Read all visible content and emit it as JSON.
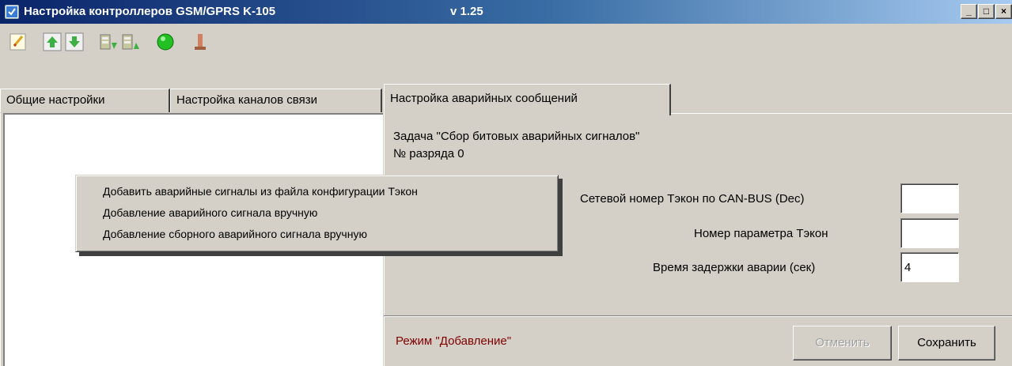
{
  "window": {
    "title": "Настройка контроллеров GSM/GPRS K-105",
    "version": "v 1.25",
    "controls": {
      "minimize": "_",
      "maximize": "□",
      "close": "×"
    }
  },
  "toolbar": {
    "buttons": [
      {
        "name": "new-icon"
      },
      {
        "name": "arrow-up-icon"
      },
      {
        "name": "arrow-down-icon"
      },
      {
        "name": "db-import-icon"
      },
      {
        "name": "db-export-icon"
      },
      {
        "name": "connect-green-icon"
      },
      {
        "name": "disconnect-icon"
      }
    ]
  },
  "tabs": [
    {
      "label": "Общие настройки"
    },
    {
      "label": "Настройка каналов связи"
    },
    {
      "label": "Настройка аварийных сообщений",
      "active": true
    }
  ],
  "form": {
    "task": "Задача \"Сбор битовых аварийных сигналов\"",
    "bit": "№ разряда 0",
    "fields": [
      {
        "label": "Сетевой номер Тэкон по CAN-BUS  (Dec)",
        "value": ""
      },
      {
        "label": "Номер параметра Тэкон",
        "value": ""
      },
      {
        "label": "Время задержки аварии (сек)",
        "value": "4"
      }
    ],
    "mode": "Режим \"Добавление\"",
    "cancel_label": "Отменить",
    "save_label": "Сохранить"
  },
  "context_menu": {
    "items": [
      "Добавить аварийные сигналы из файла конфигурации Тэкон",
      "Добавление аварийного сигнала вручную",
      "Добавление сборного аварийного сигнала вручную"
    ]
  },
  "colors": {
    "title_start": "#0a246a",
    "title_end": "#a6caf0",
    "face": "#d4d0c8",
    "mode_text": "#800000"
  }
}
